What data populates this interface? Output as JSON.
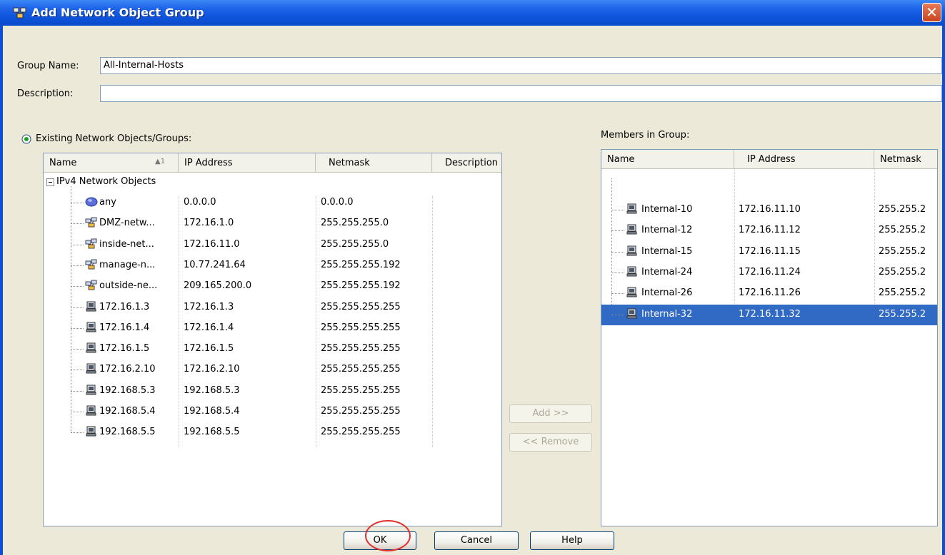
{
  "window": {
    "title": "Add Network Object Group",
    "close_glyph": "✕"
  },
  "form": {
    "group_name_label": "Group Name:",
    "group_name_value": "All-Internal-Hosts",
    "description_label": "Description:",
    "description_value": ""
  },
  "existing": {
    "label": "Existing Network Objects/Groups:",
    "columns": [
      "Name",
      "IP Address",
      "Netmask",
      "Description"
    ],
    "sort_indicator": "▲1",
    "group_label": "IPv4 Network Objects",
    "rows": [
      {
        "name": "any",
        "ip": "0.0.0.0",
        "mask": "0.0.0.0",
        "icon": "globe-icon"
      },
      {
        "name": "DMZ-netw...",
        "ip": "172.16.1.0",
        "mask": "255.255.255.0",
        "icon": "network-icon"
      },
      {
        "name": "inside-net...",
        "ip": "172.16.11.0",
        "mask": "255.255.255.0",
        "icon": "network-icon"
      },
      {
        "name": "manage-n...",
        "ip": "10.77.241.64",
        "mask": "255.255.255.192",
        "icon": "network-icon"
      },
      {
        "name": "outside-ne...",
        "ip": "209.165.200.0",
        "mask": "255.255.255.192",
        "icon": "network-icon"
      },
      {
        "name": "172.16.1.3",
        "ip": "172.16.1.3",
        "mask": "255.255.255.255",
        "icon": "host-icon"
      },
      {
        "name": "172.16.1.4",
        "ip": "172.16.1.4",
        "mask": "255.255.255.255",
        "icon": "host-icon"
      },
      {
        "name": "172.16.1.5",
        "ip": "172.16.1.5",
        "mask": "255.255.255.255",
        "icon": "host-icon"
      },
      {
        "name": "172.16.2.10",
        "ip": "172.16.2.10",
        "mask": "255.255.255.255",
        "icon": "host-icon"
      },
      {
        "name": "192.168.5.3",
        "ip": "192.168.5.3",
        "mask": "255.255.255.255",
        "icon": "host-icon"
      },
      {
        "name": "192.168.5.4",
        "ip": "192.168.5.4",
        "mask": "255.255.255.255",
        "icon": "host-icon"
      },
      {
        "name": "192.168.5.5",
        "ip": "192.168.5.5",
        "mask": "255.255.255.255",
        "icon": "host-icon"
      }
    ]
  },
  "members": {
    "label": "Members in Group:",
    "columns": [
      "Name",
      "IP Address",
      "Netmask"
    ],
    "rows": [
      {
        "name": "Internal-10",
        "ip": "172.16.11.10",
        "mask": "255.255.2",
        "selected": false
      },
      {
        "name": "Internal-12",
        "ip": "172.16.11.12",
        "mask": "255.255.2",
        "selected": false
      },
      {
        "name": "Internal-15",
        "ip": "172.16.11.15",
        "mask": "255.255.2",
        "selected": false
      },
      {
        "name": "Internal-24",
        "ip": "172.16.11.24",
        "mask": "255.255.2",
        "selected": false
      },
      {
        "name": "Internal-26",
        "ip": "172.16.11.26",
        "mask": "255.255.2",
        "selected": false
      },
      {
        "name": "Internal-32",
        "ip": "172.16.11.32",
        "mask": "255.255.2",
        "selected": true
      }
    ]
  },
  "buttons": {
    "add": "Add >>",
    "remove": "<< Remove",
    "ok": "OK",
    "cancel": "Cancel",
    "help": "Help"
  },
  "colors": {
    "titlebar": "#0a4fd6",
    "selection": "#316ac5",
    "highlight_circle": "#e03030"
  }
}
